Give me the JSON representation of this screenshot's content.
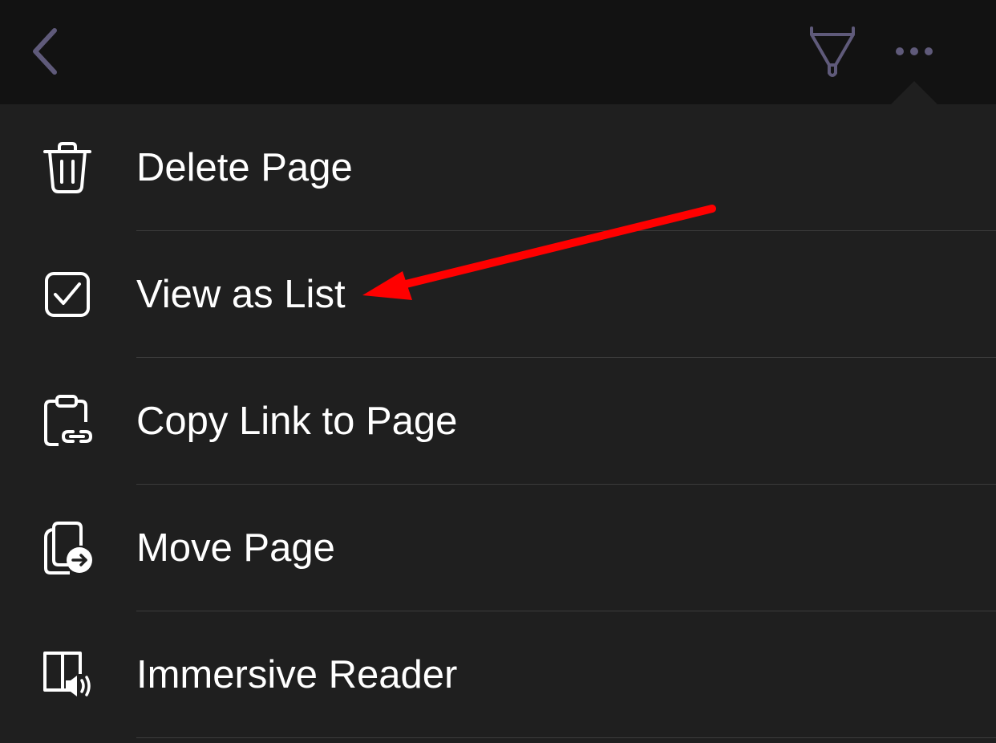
{
  "top_bar": {
    "back_icon": "chevron-left-icon",
    "pen_icon": "highlighter-pen-icon",
    "more_icon": "ellipsis-icon",
    "icon_color": "#5f5a7a",
    "background": "#121212"
  },
  "menu": {
    "background": "#1f1f1f",
    "text_color": "#ffffff",
    "items": [
      {
        "label": "Delete Page",
        "icon": "trash-icon"
      },
      {
        "label": "View as List",
        "icon": "checkbox-checked-icon"
      },
      {
        "label": "Copy Link to Page",
        "icon": "clipboard-link-icon"
      },
      {
        "label": "Move Page",
        "icon": "move-page-icon"
      },
      {
        "label": "Immersive Reader",
        "icon": "immersive-reader-icon"
      }
    ]
  },
  "annotation": {
    "type": "arrow",
    "color": "#ff0000",
    "points_to": "View as List"
  }
}
